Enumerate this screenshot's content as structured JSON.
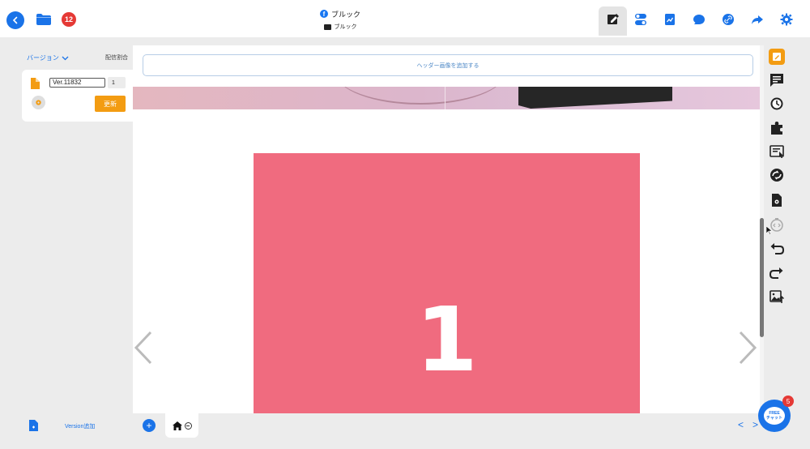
{
  "header": {
    "title": "ブルック",
    "folder_name": "ブルック",
    "badge_number": "12"
  },
  "left_panel": {
    "version_dropdown_label": "バージョン",
    "distribution_label": "配信割合",
    "version_name": "Ver.11832",
    "version_ratio": "1",
    "update_button_label": "更新"
  },
  "canvas": {
    "header_add_label": "ヘッダー画像を追加する",
    "slide_number": "1"
  },
  "bottom": {
    "version_add_label": "Version追加",
    "add_page_symbol": "+",
    "prev_symbol": "<",
    "next_symbol": ">"
  },
  "chat": {
    "line1": "FREE",
    "line2": "チャット",
    "unread_count": "5"
  },
  "colors": {
    "primary_blue": "#1a73e8",
    "accent_orange": "#f39c12",
    "slide_pink": "#f06b7f",
    "badge_red": "#e53935"
  },
  "icons": {
    "top_toolbar": [
      "edit-page-icon",
      "toggle-settings-icon",
      "stats-icon",
      "chat-icon",
      "link-icon",
      "share-icon",
      "gear-icon"
    ],
    "right_toolbar": [
      "page-settings-icon",
      "comment-icon",
      "history-icon",
      "plugin-icon",
      "text-edit-icon",
      "sync-icon",
      "doc-settings-icon",
      "code-icon",
      "undo-icon",
      "redo-icon",
      "image-upload-icon"
    ]
  }
}
